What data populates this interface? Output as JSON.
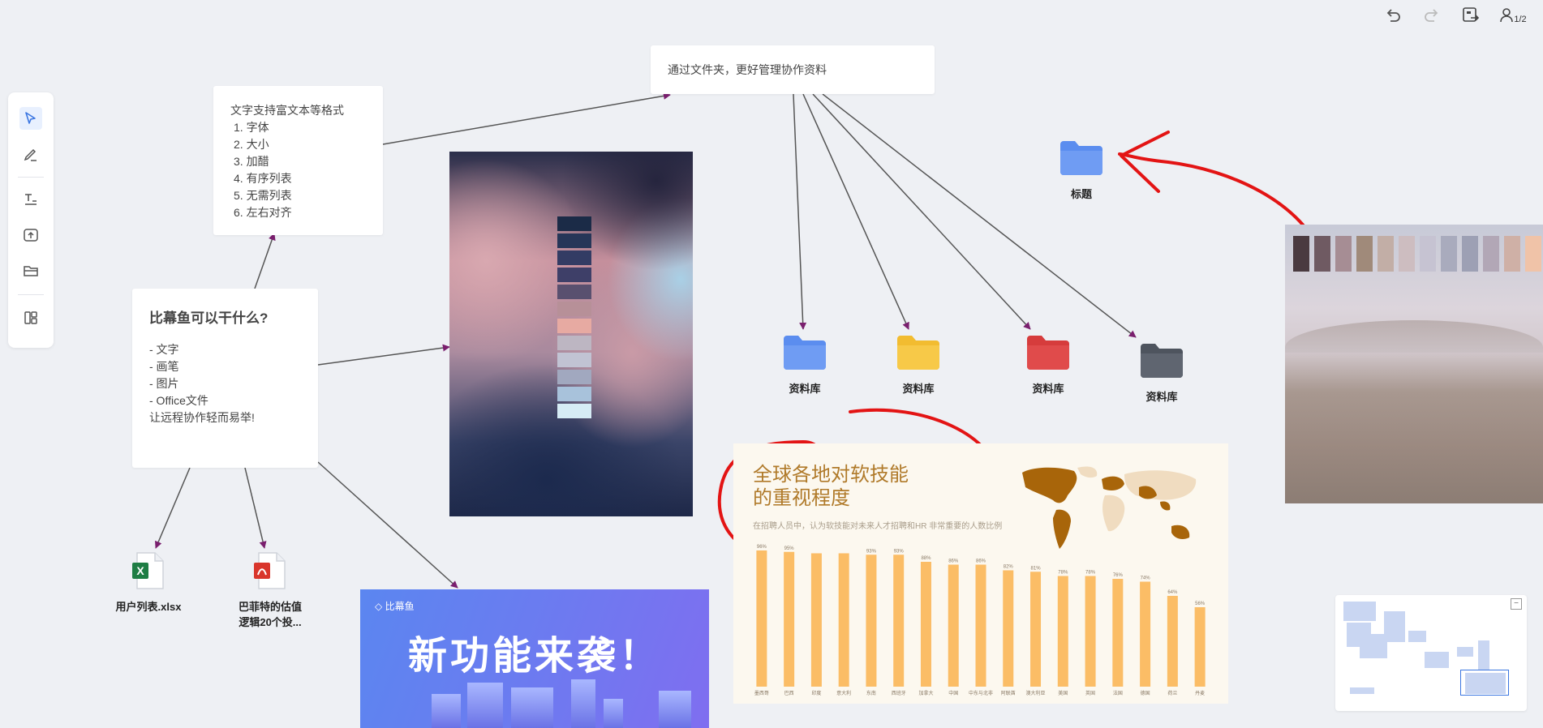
{
  "colors": {
    "canvas_bg": "#eef0f4",
    "accent_blue": "#5b8def",
    "annotation_red": "#e31414",
    "connector": "#555555",
    "arrowhead": "#7a1f6e"
  },
  "toolbar_top": {
    "undo_icon": "undo-icon",
    "redo_icon": "redo-icon",
    "present_icon": "screen-share-icon",
    "users_count": "1/2"
  },
  "toolbar_left": {
    "tools": [
      "select-icon",
      "pen-icon",
      "text-icon",
      "upload-icon",
      "folder-icon",
      "layout-icon"
    ]
  },
  "cards": {
    "richtext": {
      "lines": [
        "文字支持富文本等格式",
        "1. 字体",
        "2. 大小",
        "3. 加醋",
        "4. 有序列表",
        "5. 无需列表",
        "6. 左右对齐"
      ]
    },
    "folders_note": {
      "text": "通过文件夹，更好管理协作资料"
    },
    "main": {
      "title": "比幕鱼可以干什么?",
      "lines": [
        "- 文字",
        "- 画笔",
        "- 图片",
        "- Office文件",
        "",
        "让远程协作轻而易举!"
      ]
    }
  },
  "folders": [
    {
      "label": "资料库",
      "color": "#5b8def"
    },
    {
      "label": "资料库",
      "color": "#f7c948"
    },
    {
      "label": "资料库",
      "color": "#e04b4b"
    },
    {
      "label": "资料库",
      "color": "#5f6570"
    },
    {
      "label": "标题",
      "color": "#5b8def"
    }
  ],
  "files": [
    {
      "label": "用户列表.xlsx",
      "type": "excel-file-icon"
    },
    {
      "label": "巴菲特的估值\n逻辑20个投...",
      "type": "pdf-file-icon"
    }
  ],
  "banner": {
    "brand": "比幕鱼",
    "title": "新功能来袭！"
  },
  "infographic": {
    "title_line1": "全球各地对软技能",
    "title_line2": "的重视程度",
    "subtitle": "在招聘人员中，认为软技能对未来人才招聘和HR 非常重要的人数比例",
    "chart_data": {
      "type": "bar",
      "categories": [
        "墨西哥",
        "巴西",
        "印度",
        "意大利",
        "东南",
        "西班牙",
        "加拿大",
        "中国",
        "中东与北非",
        "阿联酋",
        "澳大利亚",
        "美国",
        "英国",
        "法国",
        "德国",
        "荷兰",
        "丹麦"
      ],
      "values": [
        96,
        95,
        94,
        94,
        93,
        93,
        88,
        86,
        86,
        82,
        81,
        78,
        78,
        76,
        74,
        64,
        56
      ],
      "value_labels": [
        "96%",
        "95%",
        "",
        "",
        "93%",
        "93%",
        "88%",
        "86%",
        "86%",
        "82%",
        "81%",
        "78%",
        "78%",
        "76%",
        "74%",
        "64%",
        "56%"
      ],
      "bar_color": "#fbbd66",
      "ylim": [
        0,
        100
      ]
    }
  },
  "minimap": {
    "collapse_label": "−"
  }
}
